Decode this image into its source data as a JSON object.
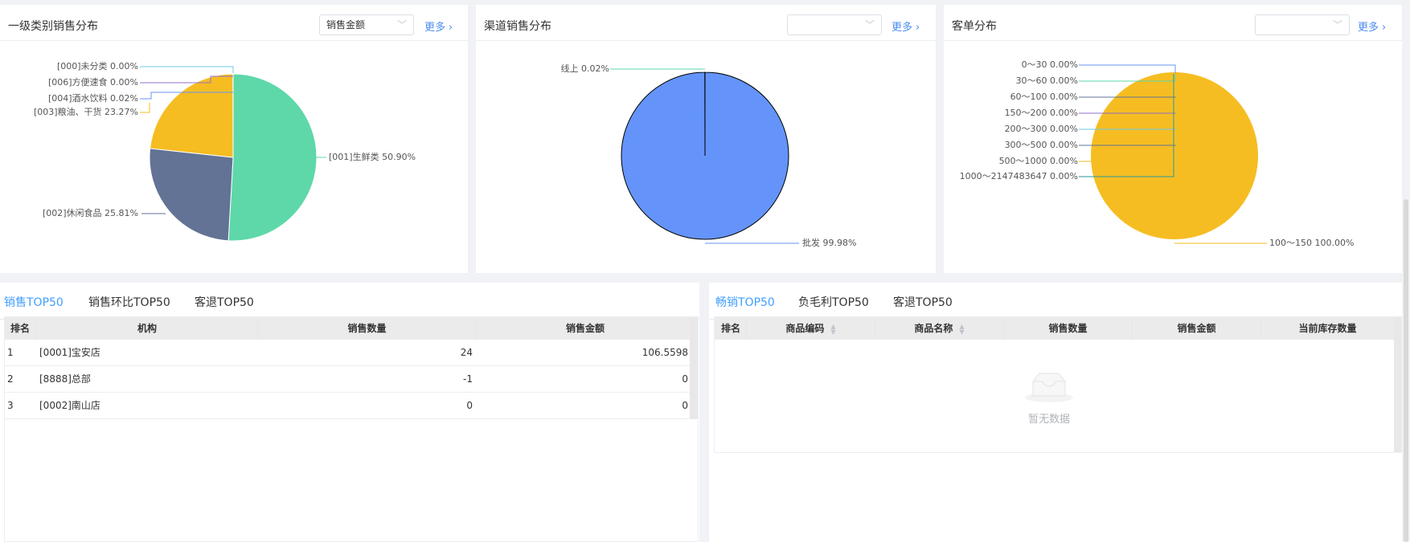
{
  "cards": {
    "category": {
      "title": "一级类别销售分布",
      "select_value": "销售金额",
      "more": "更多",
      "labels": {
        "c000": "[000]未分类 0.00%",
        "c006": "[006]方便速食 0.00%",
        "c004": "[004]酒水饮料 0.02%",
        "c003": "[003]粮油、干货 23.27%",
        "c001": "[001]生鲜类 50.90%",
        "c002": "[002]休闲食品 25.81%"
      }
    },
    "channel": {
      "title": "渠道销售分布",
      "select_value": "",
      "more": "更多",
      "labels": {
        "online": "线上 0.02%",
        "wholesale": "批发 99.98%"
      }
    },
    "ticket": {
      "title": "客单分布",
      "select_value": "",
      "more": "更多",
      "labels": {
        "r0": "0～30 0.00%",
        "r1": "30～60 0.00%",
        "r2": "60～100 0.00%",
        "r3": "150～200 0.00%",
        "r4": "200～300 0.00%",
        "r5": "300～500 0.00%",
        "r6": "500～1000 0.00%",
        "r7": "1000～2147483647 0.00%",
        "r8": "100～150 100.00%"
      }
    }
  },
  "chart_data": [
    {
      "type": "pie",
      "categories": [
        "[001]生鲜类",
        "[002]休闲食品",
        "[003]粮油、干货",
        "[004]酒水饮料",
        "[006]方便速食",
        "[000]未分类"
      ],
      "values": [
        50.9,
        25.81,
        23.27,
        0.02,
        0.0,
        0.0
      ],
      "colors": [
        "#5ed8a9",
        "#627395",
        "#f6bd22",
        "#6494f9",
        "#9270ca",
        "#6dc8ec"
      ]
    },
    {
      "type": "pie",
      "categories": [
        "批发",
        "线上"
      ],
      "values": [
        99.98,
        0.02
      ],
      "colors": [
        "#6494f9",
        "#5ed8a9"
      ]
    },
    {
      "type": "pie",
      "categories": [
        "100～150",
        "0～30",
        "30～60",
        "60～100",
        "150～200",
        "200～300",
        "300～500",
        "500～1000",
        "1000～2147483647"
      ],
      "values": [
        100.0,
        0,
        0,
        0,
        0,
        0,
        0,
        0,
        0
      ],
      "colors": [
        "#f6bd22",
        "#6494f9",
        "#5ed8a9",
        "#627395",
        "#9270ca",
        "#6dc8ec",
        "#ff9d4d",
        "#269a99",
        "#ff99c3"
      ]
    }
  ],
  "left_table": {
    "tabs": [
      "销售TOP50",
      "销售环比TOP50",
      "客退TOP50"
    ],
    "columns": [
      "排名",
      "机构",
      "销售数量",
      "销售金额"
    ],
    "rows": [
      [
        "1",
        "[0001]宝安店",
        "24",
        "106.5598"
      ],
      [
        "2",
        "[8888]总部",
        "-1",
        "0"
      ],
      [
        "3",
        "[0002]南山店",
        "0",
        "0"
      ]
    ]
  },
  "right_table": {
    "tabs": [
      "畅销TOP50",
      "负毛利TOP50",
      "客退TOP50"
    ],
    "columns": [
      "排名",
      "商品编码",
      "商品名称",
      "销售数量",
      "销售金额",
      "当前库存数量"
    ],
    "empty_text": "暂无数据"
  },
  "colors": {
    "accent": "#409eff",
    "link": "#4a8cf2"
  }
}
